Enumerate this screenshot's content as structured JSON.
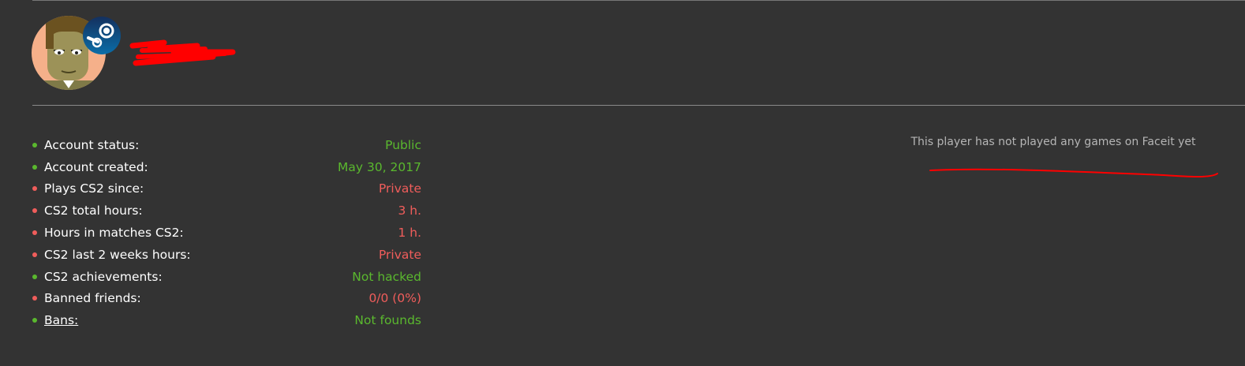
{
  "colors": {
    "background": "#333333",
    "good": "#5ab82e",
    "bad": "#f05d5b",
    "label": "#ffffff",
    "muted": "#b5b5b5",
    "redaction": "#ff0000"
  },
  "profile": {
    "avatar_icon": "avatar-cartoon-man",
    "badge_icon": "steam-logo-icon"
  },
  "stats": [
    {
      "label": "Account status:",
      "value": "Public",
      "status": "good"
    },
    {
      "label": "Account created:",
      "value": "May 30, 2017",
      "status": "good"
    },
    {
      "label": "Plays CS2 since:",
      "value": "Private",
      "status": "bad"
    },
    {
      "label": "CS2 total hours:",
      "value": "3 h.",
      "status": "bad"
    },
    {
      "label": "Hours in matches CS2:",
      "value": "1 h.",
      "status": "bad"
    },
    {
      "label": "CS2 last 2 weeks hours:",
      "value": "Private",
      "status": "bad"
    },
    {
      "label": "CS2 achievements:",
      "value": "Not hacked",
      "status": "good"
    },
    {
      "label": "Banned friends:",
      "value": "0/0 (0%)",
      "status": "bad"
    },
    {
      "label": "Bans:",
      "value": "Not founds",
      "status": "good",
      "link": true
    }
  ],
  "faceit": {
    "message": "This player has not played any games on Faceit yet"
  }
}
